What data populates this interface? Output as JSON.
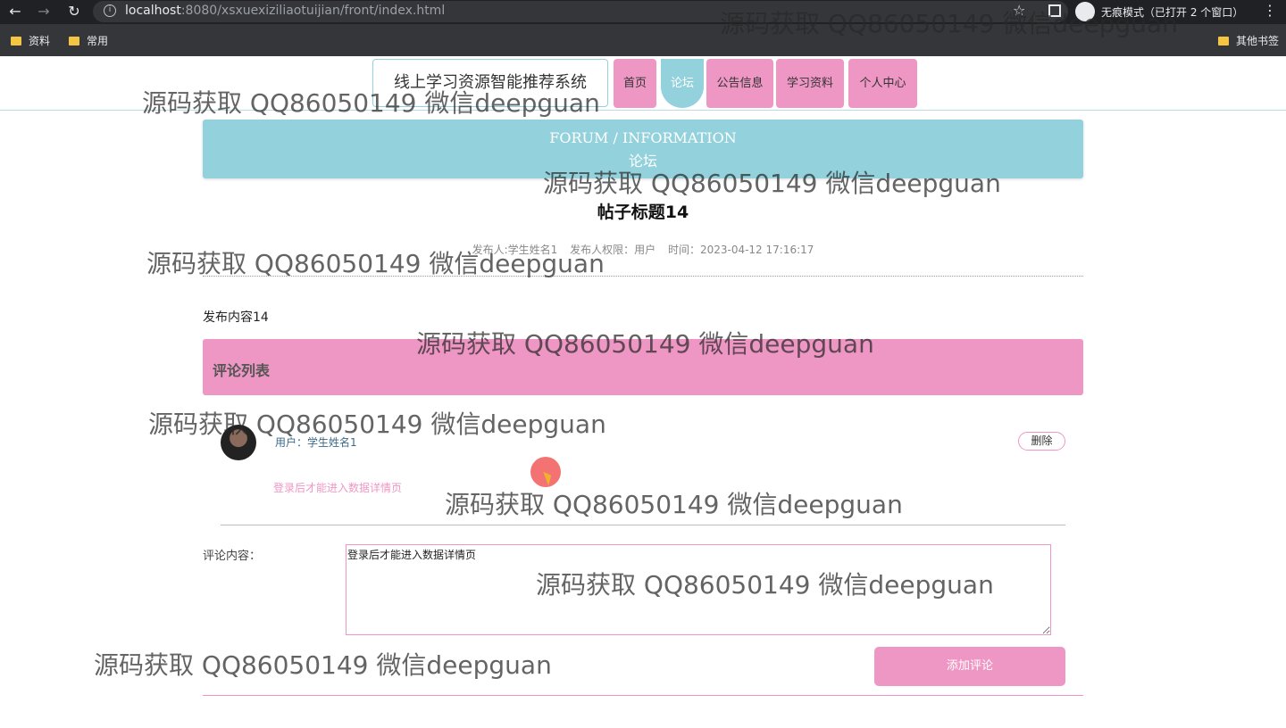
{
  "browser": {
    "back_icon": "←",
    "forward_icon": "→",
    "reload_icon": "↻",
    "url_host": "localhost",
    "url_path": ":8080/xsxuexiziliaotuijian/front/index.html",
    "star_icon": "☆",
    "menu_icon": "⋮",
    "incognito_label": "无痕模式（已打开 2 个窗口）",
    "bookmarks": [
      "资料",
      "常用"
    ],
    "other_bookmarks": "其他书签"
  },
  "header": {
    "site_title": "线上学习资源智能推荐系统",
    "nav": [
      "首页",
      "论坛",
      "公告信息",
      "学习资料",
      "个人中心"
    ],
    "active_nav": "论坛"
  },
  "banner": {
    "title_en": "FORUM / INFORMATION",
    "title_cn": "论坛"
  },
  "post": {
    "title": "帖子标题14",
    "author": "发布人:学生姓名1",
    "role": "发布人权限：用户",
    "time": "时间：2023-04-12 17:16:17",
    "content": "发布内容14"
  },
  "comments": {
    "header": "评论列表",
    "items": [
      {
        "user": "用户：学生姓名1",
        "delete_label": "删除",
        "text": "登录后才能进入数据详情页"
      }
    ]
  },
  "comment_form": {
    "label": "评论内容：",
    "value": "登录后才能进入数据详情页",
    "submit_label": "添加评论"
  },
  "watermark": "源码获取 QQ86050149 微信deepguan",
  "colors": {
    "accent_teal": "#93d2dc",
    "accent_pink": "#ef97c4"
  }
}
